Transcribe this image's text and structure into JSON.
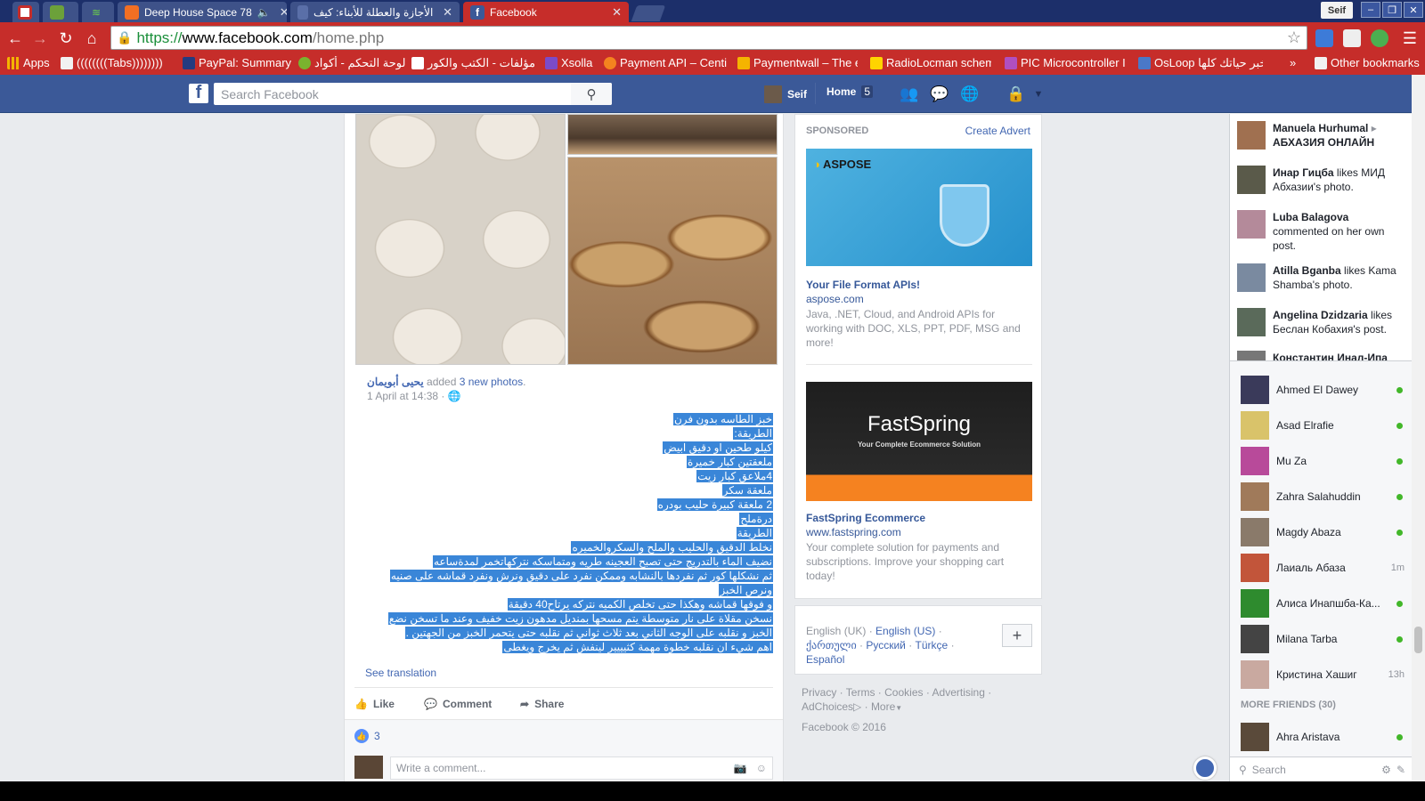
{
  "browser": {
    "tabs": [
      {
        "title": "",
        "icon": "vk-icon"
      },
      {
        "title": "",
        "icon": "rt-icon"
      },
      {
        "title": "",
        "icon": "wifi-icon"
      },
      {
        "title": "Deep House Space 78",
        "icon": "soundcloud-icon",
        "audio": true
      },
      {
        "title": "الأجازة والعطلة للأبناء: كيف",
        "icon": "page-icon"
      },
      {
        "title": "Facebook",
        "icon": "facebook-icon"
      },
      {
        "title": "",
        "icon": "new-tab"
      }
    ],
    "user_badge": "Seif",
    "url": {
      "scheme": "https://",
      "host": "www.facebook.com",
      "path": "/home.php"
    },
    "bookmarks": [
      {
        "label": "Apps",
        "icon": "apps-grid-icon"
      },
      {
        "label": "((((((((Tabs))))))))",
        "icon": "folder-icon"
      },
      {
        "label": "PayPal: Summary",
        "icon": "paypal-icon"
      },
      {
        "label": "لوحة التحكم - أكواد",
        "icon": "page-icon"
      },
      {
        "label": "مؤلفات - الكتب والكور",
        "icon": "page-icon"
      },
      {
        "label": "Xsolla",
        "icon": "xsolla-icon"
      },
      {
        "label": "Payment API – Centi",
        "icon": "page-icon"
      },
      {
        "label": "Paymentwall – The e",
        "icon": "page-icon"
      },
      {
        "label": "RadioLocman schem",
        "icon": "rl-icon"
      },
      {
        "label": "PIC Microcontroller I",
        "icon": "page-icon"
      },
      {
        "label": "OsLoop خبر حياتك كلها",
        "icon": "page-icon"
      },
      {
        "label": "»",
        "icon": ""
      },
      {
        "label": "Other bookmarks",
        "icon": "folder-icon"
      }
    ]
  },
  "fb": {
    "search_placeholder": "Search Facebook",
    "user_name": "Seif",
    "home_label": "Home",
    "home_count": "5"
  },
  "post": {
    "author": "يحيى أبويمان",
    "added_text": "added",
    "photos_link": "3 new photos",
    "timestamp": "1 April at 14:38 ·",
    "lines": [
      "خبز الطاسه بدون فرن",
      "الطريقة:",
      "كيلو طحين او دقيق ابيض",
      "ملعقتين كبار خميرة",
      "4ملاعق كبار زيت",
      "ملعقة سكر",
      "2 ملعقة كبيرة حليب بودره",
      "درةملح",
      "الطريقة",
      "نخلط الدقيق والحليب والملح والسكروالخميره",
      "نضيف الماء بالتدريج حتى تصبح العجينه طريه ومتماسكه نتركهاتخمر لمدةساعه",
      "ثم نشكلها كور ثم نفردها بالنشابه وممكن نفرد على دقيق ونرش ونفرد قماشه على صنيه",
      "ونرص الخبز",
      "و فوقها قماشه وهكذا حتى تخلص الكميه نتركه يرتاح40 دقيقة",
      "نسخن مقلاة على نار متوسطة يتم مسحها بمنديل مدهون زيت خفيف وعند ما تسخن نضع",
      "الخبز و نقلبه على الوجه الثاني بعد ثلاث ثواني ثم نقلبه حتى يتحمر الخبز من الجهتين .",
      "اهم شيء ان نقلبه خطوة مهمة كثيييير لينفش ثم يخرج ويغطى"
    ],
    "see_translation": "See translation",
    "actions": {
      "like": "Like",
      "comment": "Comment",
      "share": "Share"
    },
    "like_count": "3",
    "comment_placeholder": "Write a comment..."
  },
  "ads": {
    "sponsored": "SPONSORED",
    "create_advert": "Create Advert",
    "items": [
      {
        "brand": "ASPOSE",
        "title": "Your File Format APIs!",
        "url": "aspose.com",
        "desc": "Java, .NET, Cloud, and Android APIs for working with DOC, XLS, PPT, PDF, MSG and more!"
      },
      {
        "brand": "FastSpring",
        "brand_tagline": "Your Complete Ecommerce Solution",
        "title": "FastSpring Ecommerce",
        "url": "www.fastspring.com",
        "desc": "Your complete solution for payments and subscriptions. Improve your shopping cart today!"
      }
    ]
  },
  "languages": {
    "current": "English (UK)",
    "others": [
      "English (US)",
      "ქართული",
      "Русский",
      "Türkçe",
      "Español"
    ],
    "add": "+"
  },
  "footer": {
    "links": [
      "Privacy",
      "Terms",
      "Cookies",
      "Advertising",
      "AdChoices",
      "More"
    ],
    "copyright": "Facebook © 2016"
  },
  "ticker": [
    {
      "name": "Manuela Hurhumal",
      "extra": "▸",
      "text": "АБХАЗИЯ ОНЛАЙН"
    },
    {
      "name": "Инар Гицба",
      "text": "likes МИД Абхазии's photo."
    },
    {
      "name": "Luba Balagova",
      "text": "commented on her own post."
    },
    {
      "name": "Atilla Bganba",
      "text": "likes Kama Shamba's photo."
    },
    {
      "name": "Angelina Dzidzaria",
      "text": "likes Беслан Кобахия's post."
    },
    {
      "name": "Константин Инал-Ипа",
      "text": ""
    }
  ],
  "friends": [
    {
      "name": "Ahmed El Dawey",
      "status": "online",
      "color": "#3a3a5a"
    },
    {
      "name": "Asad Elrafie",
      "status": "online",
      "color": "#d9c36a"
    },
    {
      "name": "Mu Za",
      "status": "online",
      "color": "#b84a9a"
    },
    {
      "name": "Zahra Salahuddin",
      "status": "online",
      "color": "#a07a5a"
    },
    {
      "name": "Magdy Abaza",
      "status": "online",
      "color": "#8a7a6a"
    },
    {
      "name": "Лаиаль Абаза",
      "status": "1m",
      "color": "#c2553a"
    },
    {
      "name": "Алиса Инапшба-Ка...",
      "status": "online",
      "color": "#2e8b2e"
    },
    {
      "name": "Milana Tarba",
      "status": "online",
      "color": "#444"
    },
    {
      "name": "Кристина Хашиг",
      "status": "13h",
      "color": "#c9a9a0"
    }
  ],
  "more_friends": "MORE FRIENDS (30)",
  "more_friends_list": [
    {
      "name": "Ahra Aristava",
      "status": "online",
      "color": "#5a4a3a"
    }
  ],
  "chat_search_placeholder": "Search"
}
